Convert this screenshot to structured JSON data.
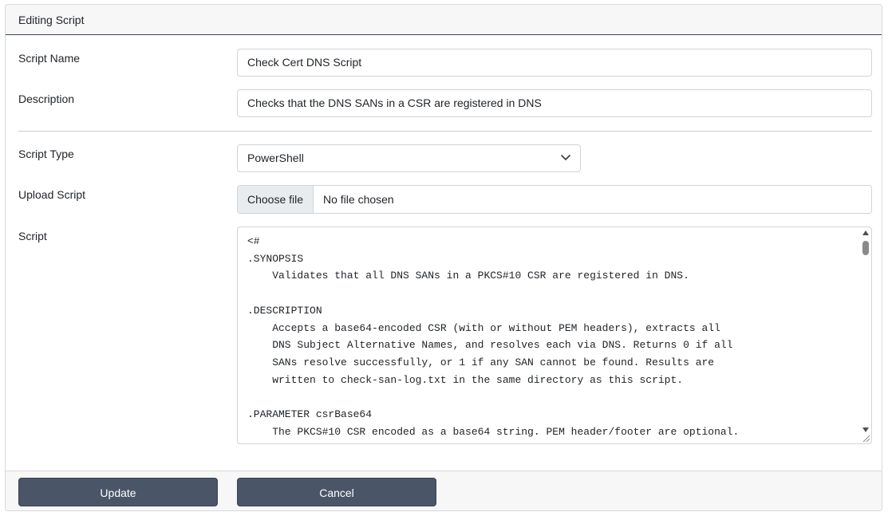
{
  "card": {
    "title": "Editing Script"
  },
  "form": {
    "script_name": {
      "label": "Script Name",
      "value": "Check Cert DNS Script"
    },
    "description": {
      "label": "Description",
      "value": "Checks that the DNS SANs in a CSR are registered in DNS"
    },
    "script_type": {
      "label": "Script Type",
      "selected": "PowerShell"
    },
    "upload_script": {
      "label": "Upload Script",
      "button_label": "Choose file",
      "status": "No file chosen"
    },
    "script": {
      "label": "Script",
      "content": "<#\n.SYNOPSIS\n    Validates that all DNS SANs in a PKCS#10 CSR are registered in DNS.\n\n.DESCRIPTION\n    Accepts a base64-encoded CSR (with or without PEM headers), extracts all\n    DNS Subject Alternative Names, and resolves each via DNS. Returns 0 if all\n    SANs resolve successfully, or 1 if any SAN cannot be found. Results are\n    written to check-san-log.txt in the same directory as this script.\n\n.PARAMETER csrBase64\n    The PKCS#10 CSR encoded as a base64 string. PEM header/footer are optional."
    }
  },
  "footer": {
    "update_label": "Update",
    "cancel_label": "Cancel"
  },
  "icons": {
    "select_chevron": "chevron-down-icon",
    "scroll_up": "scroll-up-arrow-icon",
    "scroll_down": "scroll-down-arrow-icon",
    "resize": "resize-handle-icon"
  },
  "colors": {
    "button_bg": "#4a5568",
    "header_border": "#3c4350"
  }
}
